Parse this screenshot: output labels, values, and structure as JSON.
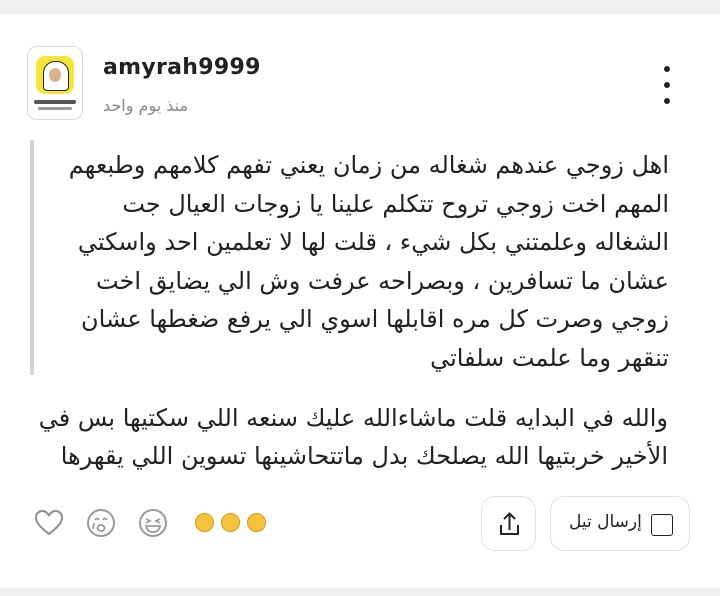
{
  "post": {
    "username": "amyrah9999",
    "time": "منذ يوم واحد",
    "quote": "اهل زوجي عندهم شغاله من زمان يعني تفهم كلامهم وطبعهم المهم اخت زوجي تروح تتكلم علينا يا زوجات العيال جت الشغاله وعلمتني بكل شيء ، قلت لها لا تعلمين احد واسكتي عشان ما تسافرين ، وبصراحه عرفت وش الي يضايق اخت زوجي وصرت كل مره اقابلها اسوي الي يرفع ضغطها عشان تنقهر وما علمت سلفاتي",
    "comment": "والله في البدايه قلت ماشاءالله عليك سنعه اللي سكتيها بس في الأخير خربتيها الله يصلحك بدل ماتتحاشينها تسوين اللي يقهرها"
  },
  "actions": {
    "send_label": "إرسال تيل",
    "icons": {
      "like": "heart-icon",
      "cry": "crying-face-icon",
      "laugh": "laughing-face-icon",
      "reactions": "reaction-emoji-icons",
      "share": "share-icon",
      "send": "note-icon",
      "menu": "kebab-menu-icon"
    }
  }
}
